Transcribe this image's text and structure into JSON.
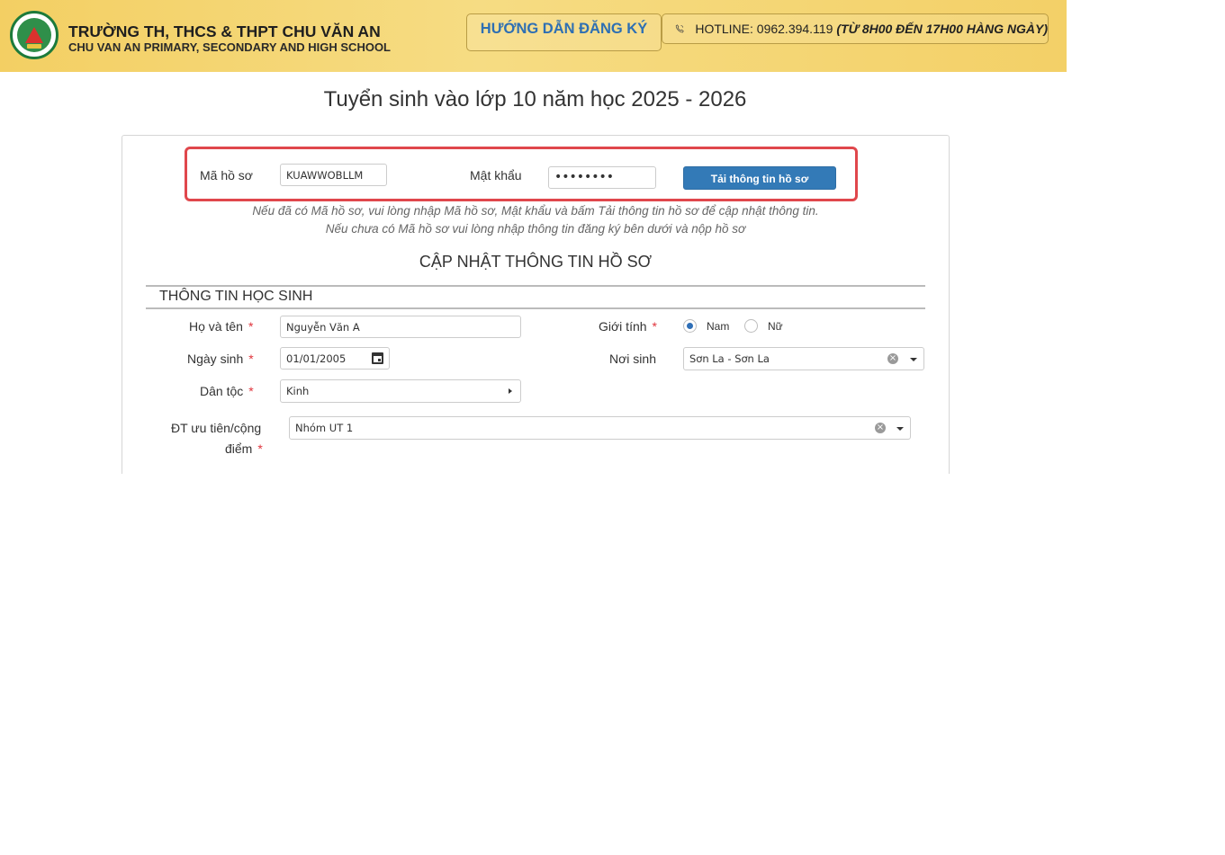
{
  "header": {
    "school_name_vi": "TRƯỜNG TH, THCS & THPT CHU VĂN AN",
    "school_name_en": "CHU VAN AN PRIMARY, SECONDARY AND HIGH SCHOOL",
    "guide_button": "HƯỚNG DẪN ĐĂNG KÝ",
    "hotline_text": "HOTLINE: 0962.394.119",
    "hotline_hours": "(TỪ 8H00 ĐẾN 17H00 HÀNG NGÀY)",
    "brand_color": "#f3cf63"
  },
  "page_title": "Tuyển sinh vào lớp 10 năm học 2025 - 2026",
  "login": {
    "code_label": "Mã hồ sơ",
    "code_value": "KUAWWOBLLM",
    "password_label": "Mật khẩu",
    "password_value": "••••••••",
    "load_button": "Tải thông tin hồ sơ",
    "highlight_color": "#e0474c"
  },
  "hints": {
    "line1": "Nếu đã có Mã hồ sơ, vui lòng nhập Mã hồ sơ, Mật khẩu và bấm Tải thông tin hồ sơ để cập nhật thông tin.",
    "line2": "Nếu chưa có Mã hồ sơ vui lòng nhập thông tin đăng ký bên dưới và nộp hồ sơ"
  },
  "section_title": "CẬP NHẬT THÔNG TIN HỒ SƠ",
  "student": {
    "heading": "THÔNG TIN HỌC SINH",
    "required_mark": "*",
    "fullname_label": "Họ và tên",
    "fullname_value": "Nguyễn Văn A",
    "gender_label": "Giới tính",
    "gender_options": [
      "Nam",
      "Nữ"
    ],
    "gender_selected": "Nam",
    "dob_label": "Ngày sinh",
    "dob_value": "01/01/2005",
    "birthplace_label": "Nơi sinh",
    "birthplace_value": "Sơn La - Sơn La",
    "ethnicity_label": "Dân tộc",
    "ethnicity_value": "Kinh",
    "priority_label_line1": "ĐT ưu tiên/cộng",
    "priority_label_line2": "điểm",
    "priority_value": "Nhóm UT 1"
  }
}
